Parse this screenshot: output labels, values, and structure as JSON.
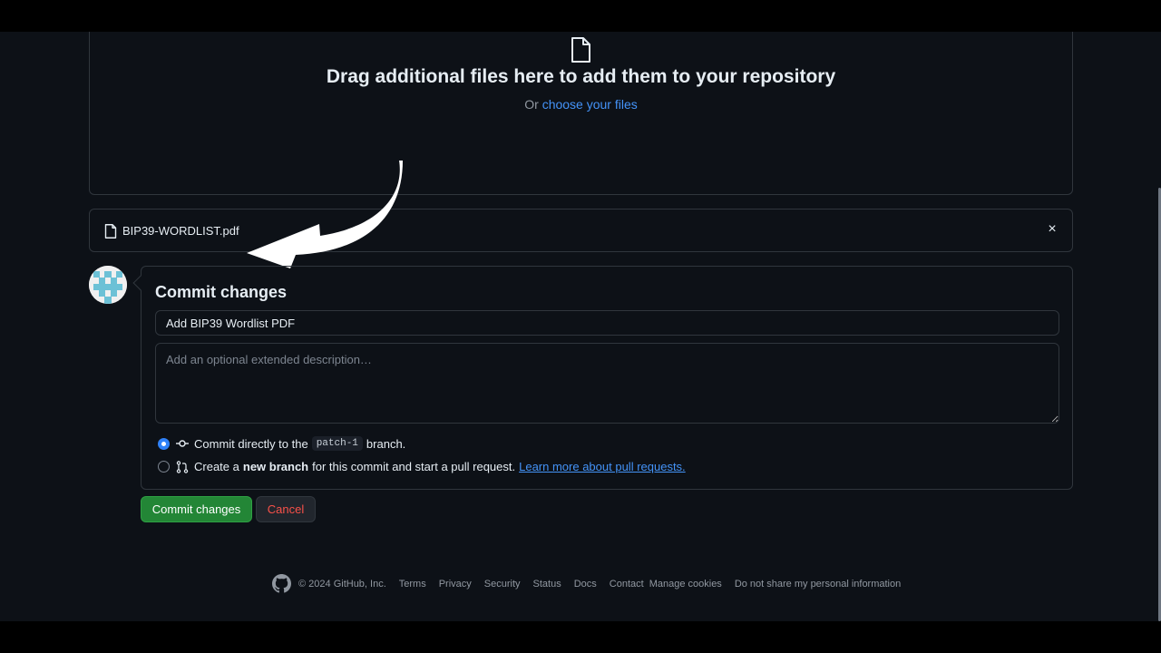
{
  "dropzone": {
    "title": "Drag additional files here to add them to your repository",
    "or_text": "Or",
    "choose_link": "choose your files"
  },
  "file": {
    "name": "BIP39-WORDLIST.pdf",
    "close_glyph": "×"
  },
  "commit": {
    "title": "Commit changes",
    "message_value": "Add BIP39 Wordlist PDF",
    "description_placeholder": "Add an optional extended description…",
    "option_direct": {
      "prefix": "Commit directly to the",
      "branch": "patch-1",
      "suffix": "branch."
    },
    "option_new": {
      "prefix": "Create a",
      "bold": "new branch",
      "suffix": "for this commit and start a pull request.",
      "link": "Learn more about pull requests."
    },
    "submit_label": "Commit changes",
    "cancel_label": "Cancel"
  },
  "footer": {
    "copyright": "© 2024 GitHub, Inc.",
    "links": [
      "Terms",
      "Privacy",
      "Security",
      "Status",
      "Docs",
      "Contact",
      "Manage cookies",
      "Do not share my personal information"
    ]
  },
  "colors": {
    "background": "#0d1117",
    "border": "#30363d",
    "link": "#4493f8",
    "primary_button": "#238636",
    "danger_text": "#f85149"
  }
}
